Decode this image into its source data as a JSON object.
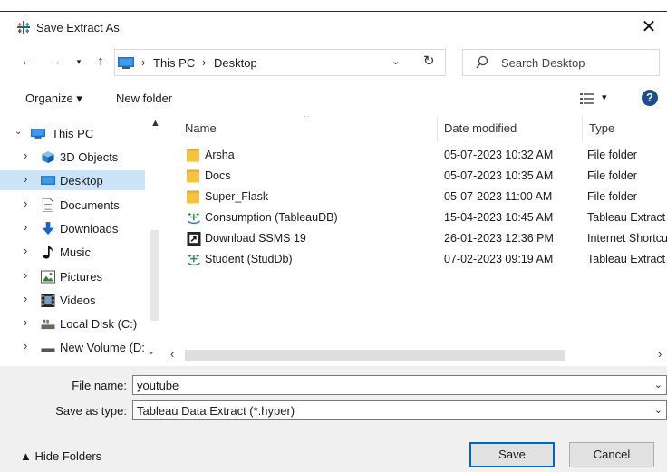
{
  "window": {
    "title": "Save Extract As",
    "close_glyph": "✕"
  },
  "nav": {
    "back_glyph": "←",
    "forward_glyph": "→",
    "recent_glyph": "▾",
    "up_glyph": "↑",
    "breadcrumbs": [
      "This PC",
      "Desktop"
    ],
    "separator": "›",
    "dropdown_glyph": "⌄",
    "refresh_glyph": "↻"
  },
  "search": {
    "placeholder": "Search Desktop"
  },
  "toolbar": {
    "organize_label": "Organize ▾",
    "new_folder_label": "New folder",
    "view_dropdown_glyph": "▾",
    "help_glyph": "?"
  },
  "sidebar": {
    "items": [
      {
        "label": "This PC",
        "icon": "computer-icon",
        "chevron": "⌄"
      },
      {
        "label": "3D Objects",
        "icon": "cube-icon",
        "chevron": "›"
      },
      {
        "label": "Desktop",
        "icon": "desktop-icon",
        "chevron": "›",
        "selected": true
      },
      {
        "label": "Documents",
        "icon": "document-icon",
        "chevron": "›"
      },
      {
        "label": "Downloads",
        "icon": "download-arrow-icon",
        "chevron": "›"
      },
      {
        "label": "Music",
        "icon": "music-note-icon",
        "chevron": "›"
      },
      {
        "label": "Pictures",
        "icon": "pictures-icon",
        "chevron": "›"
      },
      {
        "label": "Videos",
        "icon": "film-icon",
        "chevron": "›"
      },
      {
        "label": "Local Disk (C:)",
        "icon": "drive-icon",
        "chevron": "›"
      },
      {
        "label": "New Volume (D:",
        "icon": "drive-icon",
        "chevron": "›"
      }
    ],
    "scroll_up_glyph": "▲",
    "scroll_down_glyph": "⌄"
  },
  "file_list": {
    "columns": {
      "name": "Name",
      "date": "Date modified",
      "type": "Type"
    },
    "sort_glyph": "^",
    "rows": [
      {
        "name": "Arsha",
        "date": "05-07-2023 10:32 AM",
        "type": "File folder",
        "icon": "folder-icon"
      },
      {
        "name": "Docs",
        "date": "05-07-2023 10:35 AM",
        "type": "File folder",
        "icon": "folder-icon"
      },
      {
        "name": "Super_Flask",
        "date": "05-07-2023 11:00 AM",
        "type": "File folder",
        "icon": "folder-icon"
      },
      {
        "name": "Consumption (TableauDB)",
        "date": "15-04-2023 10:45 AM",
        "type": "Tableau Extract",
        "icon": "tableau-extract-icon"
      },
      {
        "name": "Download SSMS 19",
        "date": "26-01-2023 12:36 PM",
        "type": "Internet Shortcut",
        "icon": "shortcut-icon"
      },
      {
        "name": "Student (StudDb)",
        "date": "07-02-2023 09:19 AM",
        "type": "Tableau Extract",
        "icon": "tableau-extract-icon"
      }
    ],
    "scroll_left_glyph": "‹",
    "scroll_right_glyph": "›"
  },
  "form": {
    "file_name_label": "File name:",
    "file_name_value": "youtube",
    "save_type_label": "Save as type:",
    "save_type_value": "Tableau Data Extract (*.hyper)",
    "dropdown_glyph": "⌄"
  },
  "footer": {
    "hide_folders_label": "▲  Hide Folders",
    "save_label": "Save",
    "cancel_label": "Cancel"
  },
  "colors": {
    "selected_bg": "#cce4f7",
    "folder": "#f5c342",
    "accent": "#0067c0",
    "tableau": "#2e8b57"
  }
}
